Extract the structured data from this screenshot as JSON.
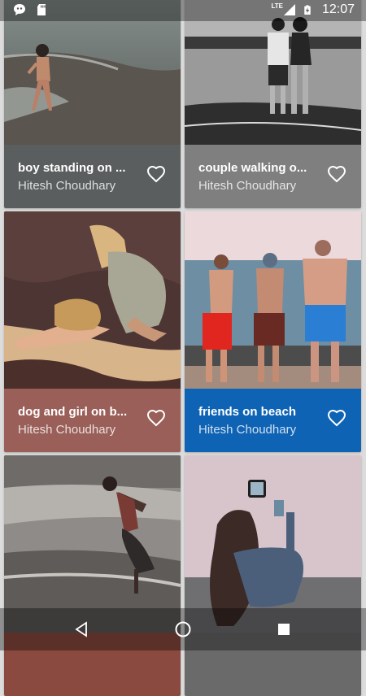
{
  "status_bar": {
    "time": "12:07",
    "network": "LTE",
    "icons": [
      "chat-bubble-icon",
      "sd-card-icon",
      "signal-icon",
      "battery-charging-icon"
    ]
  },
  "cards": [
    {
      "title": "boy standing on ...",
      "author": "Hitesh Choudhary",
      "footer_color": "#5a5e5e"
    },
    {
      "title": "couple walking o...",
      "author": "Hitesh Choudhary",
      "footer_color": "#7f7f7f"
    },
    {
      "title": "dog and girl on b...",
      "author": "Hitesh Choudhary",
      "footer_color": "#9a5f58"
    },
    {
      "title": "friends on beach",
      "author": "Hitesh Choudhary",
      "footer_color": "#0f63b5"
    },
    {
      "title": "",
      "author": "",
      "footer_color": "#8a4a3f"
    },
    {
      "title": "",
      "author": "",
      "footer_color": "#6a6a6a"
    }
  ],
  "nav_bar": {
    "icons": [
      "back-icon",
      "home-icon",
      "recents-icon"
    ]
  }
}
